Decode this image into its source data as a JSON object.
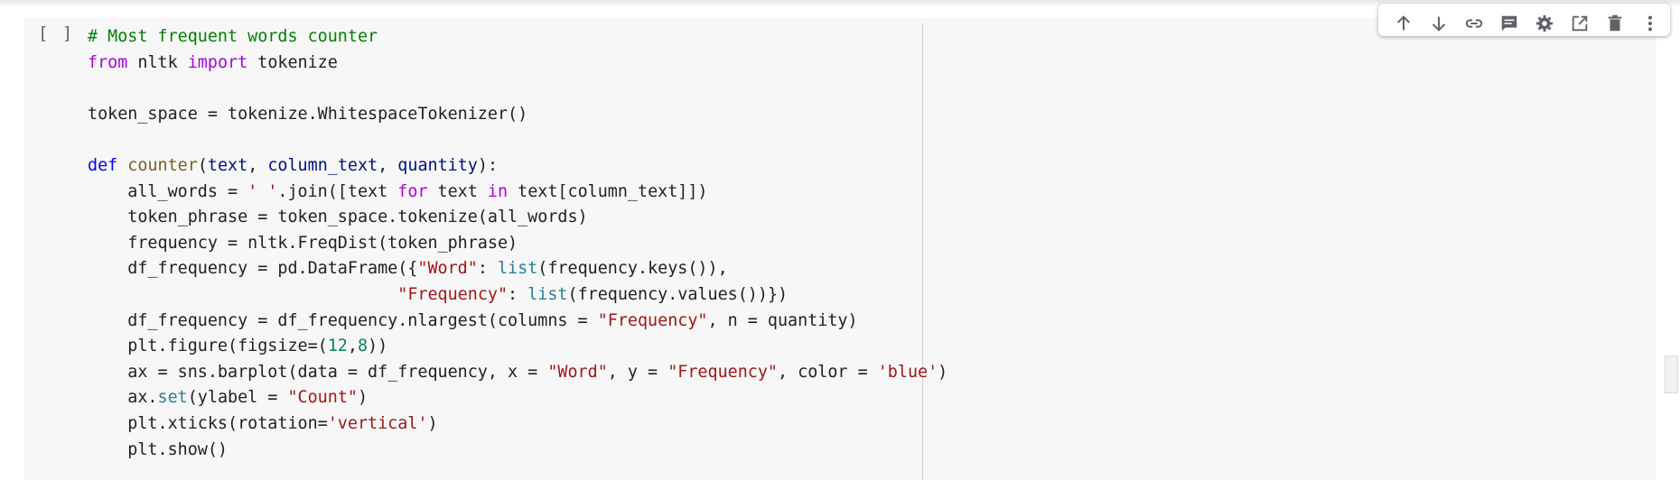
{
  "cell": {
    "run_indicator": "[ ]",
    "code_lines": [
      [
        {
          "t": "# Most frequent words counter",
          "c": "comment"
        }
      ],
      [
        {
          "t": "from",
          "c": "kw"
        },
        {
          "t": " nltk ",
          "c": "plain"
        },
        {
          "t": "import",
          "c": "kw"
        },
        {
          "t": " tokenize",
          "c": "plain"
        }
      ],
      [
        {
          "t": "",
          "c": "plain"
        }
      ],
      [
        {
          "t": "token_space = tokenize.WhitespaceTokenizer()",
          "c": "plain"
        }
      ],
      [
        {
          "t": "",
          "c": "plain"
        }
      ],
      [
        {
          "t": "def",
          "c": "def"
        },
        {
          "t": " ",
          "c": "plain"
        },
        {
          "t": "counter",
          "c": "fn"
        },
        {
          "t": "(",
          "c": "plain"
        },
        {
          "t": "text",
          "c": "param"
        },
        {
          "t": ", ",
          "c": "plain"
        },
        {
          "t": "column_text",
          "c": "param"
        },
        {
          "t": ", ",
          "c": "plain"
        },
        {
          "t": "quantity",
          "c": "param"
        },
        {
          "t": "):",
          "c": "plain"
        }
      ],
      [
        {
          "t": "    all_words = ",
          "c": "plain"
        },
        {
          "t": "' '",
          "c": "str"
        },
        {
          "t": ".join([text ",
          "c": "plain"
        },
        {
          "t": "for",
          "c": "kw"
        },
        {
          "t": " text ",
          "c": "plain"
        },
        {
          "t": "in",
          "c": "kw"
        },
        {
          "t": " text[column_text]])",
          "c": "plain"
        }
      ],
      [
        {
          "t": "    token_phrase = token_space.tokenize(all_words)",
          "c": "plain"
        }
      ],
      [
        {
          "t": "    frequency = nltk.FreqDist(token_phrase)",
          "c": "plain"
        }
      ],
      [
        {
          "t": "    df_frequency = pd.DataFrame({",
          "c": "plain"
        },
        {
          "t": "\"Word\"",
          "c": "str"
        },
        {
          "t": ": ",
          "c": "plain"
        },
        {
          "t": "list",
          "c": "builtin"
        },
        {
          "t": "(frequency.keys()),",
          "c": "plain"
        }
      ],
      [
        {
          "t": "                               ",
          "c": "plain"
        },
        {
          "t": "\"Frequency\"",
          "c": "str"
        },
        {
          "t": ": ",
          "c": "plain"
        },
        {
          "t": "list",
          "c": "builtin"
        },
        {
          "t": "(frequency.values())})",
          "c": "plain"
        }
      ],
      [
        {
          "t": "    df_frequency = df_frequency.nlargest(columns = ",
          "c": "plain"
        },
        {
          "t": "\"Frequency\"",
          "c": "str"
        },
        {
          "t": ", n = quantity)",
          "c": "plain"
        }
      ],
      [
        {
          "t": "    plt.figure(figsize=(",
          "c": "plain"
        },
        {
          "t": "12",
          "c": "num"
        },
        {
          "t": ",",
          "c": "plain"
        },
        {
          "t": "8",
          "c": "num"
        },
        {
          "t": "))",
          "c": "plain"
        }
      ],
      [
        {
          "t": "    ax = sns.barplot(data = df_frequency, x = ",
          "c": "plain"
        },
        {
          "t": "\"Word\"",
          "c": "str"
        },
        {
          "t": ", y = ",
          "c": "plain"
        },
        {
          "t": "\"Frequency\"",
          "c": "str"
        },
        {
          "t": ", color = ",
          "c": "plain"
        },
        {
          "t": "'blue'",
          "c": "str"
        },
        {
          "t": ")",
          "c": "plain"
        }
      ],
      [
        {
          "t": "    ax.",
          "c": "plain"
        },
        {
          "t": "set",
          "c": "builtin"
        },
        {
          "t": "(ylabel = ",
          "c": "plain"
        },
        {
          "t": "\"Count\"",
          "c": "str"
        },
        {
          "t": ")",
          "c": "plain"
        }
      ],
      [
        {
          "t": "    plt.xticks(rotation=",
          "c": "plain"
        },
        {
          "t": "'vertical'",
          "c": "str"
        },
        {
          "t": ")",
          "c": "plain"
        }
      ],
      [
        {
          "t": "    plt.show()",
          "c": "plain"
        }
      ]
    ]
  },
  "toolbar": {
    "icons": [
      {
        "name": "move-cell-up-icon"
      },
      {
        "name": "move-cell-down-icon"
      },
      {
        "name": "link-icon"
      },
      {
        "name": "comment-icon"
      },
      {
        "name": "settings-gear-icon"
      },
      {
        "name": "open-in-tab-icon"
      },
      {
        "name": "delete-icon"
      },
      {
        "name": "more-options-icon"
      }
    ]
  },
  "colors": {
    "comment": "#008000",
    "keyword": "#af00db",
    "def": "#0000ff",
    "function": "#795e26",
    "param": "#001080",
    "string": "#a31515",
    "number": "#098658",
    "builtin": "#267f99",
    "cell_background": "#f7f7f7",
    "icon": "#5f6368"
  }
}
